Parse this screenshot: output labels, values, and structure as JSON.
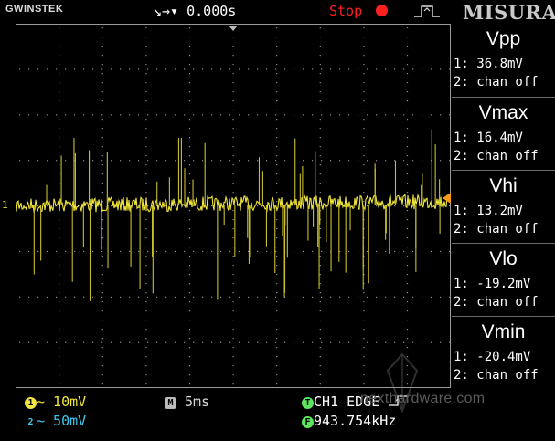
{
  "topbar": {
    "brand": "GWINSTEK",
    "timebase": "↘→▾ 0.000s",
    "run_state": "Stop",
    "run_color": "#ff2020",
    "watermark_brand": "MISURA"
  },
  "measurements": [
    {
      "name": "Vpp",
      "ch1": "1: 36.8mV",
      "ch2": "2: chan off"
    },
    {
      "name": "Vmax",
      "ch1": "1: 16.4mV",
      "ch2": "2: chan off"
    },
    {
      "name": "Vhi",
      "ch1": "1: 13.2mV",
      "ch2": "2: chan off"
    },
    {
      "name": "Vlo",
      "ch1": "1: -19.2mV",
      "ch2": "2: chan off"
    },
    {
      "name": "Vmin",
      "ch1": "1: -20.4mV",
      "ch2": "2: chan off"
    }
  ],
  "bottom": {
    "ch1_badge": "1",
    "ch1_scale": "~ 10mV",
    "ch2_badge": "2",
    "ch2_scale": "~ 50mV",
    "h_badge": "M",
    "h_scale": "5ms",
    "trig_badge": "T",
    "trig_source": "CH1",
    "trig_type": "EDGE",
    "trig_slope_icon": "rising-edge-icon",
    "freq_badge": "F",
    "frequency": "943.754kHz",
    "watermark": "nexthardware.com"
  },
  "colors": {
    "ch1": "#f0e63c",
    "ch2": "#3cc9f0",
    "grid": "#9a9a9a",
    "trigger": "#ff9a1a"
  },
  "markers": {
    "ch1_ground": "1"
  }
}
